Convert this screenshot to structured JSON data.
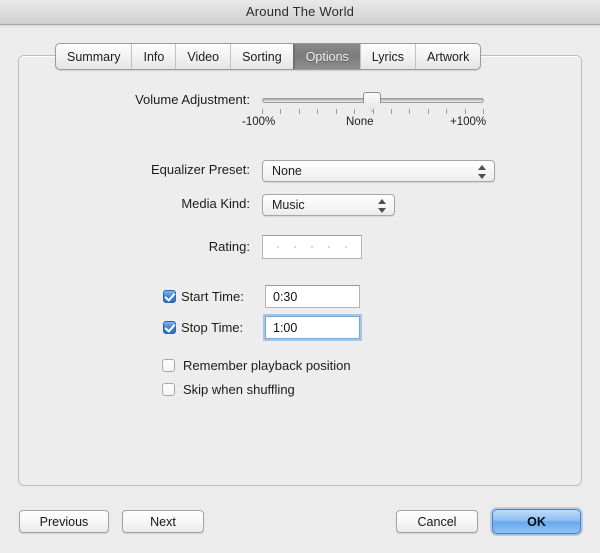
{
  "window": {
    "title": "Around The World"
  },
  "tabs": [
    {
      "label": "Summary",
      "active": false
    },
    {
      "label": "Info",
      "active": false
    },
    {
      "label": "Video",
      "active": false
    },
    {
      "label": "Sorting",
      "active": false
    },
    {
      "label": "Options",
      "active": true
    },
    {
      "label": "Lyrics",
      "active": false
    },
    {
      "label": "Artwork",
      "active": false
    }
  ],
  "form": {
    "volume": {
      "label": "Volume Adjustment:",
      "min_label": "-100%",
      "mid_label": "None",
      "max_label": "+100%",
      "value": "None",
      "tick_count": 13
    },
    "equalizer": {
      "label": "Equalizer Preset:",
      "value": "None"
    },
    "media_kind": {
      "label": "Media Kind:",
      "value": "Music"
    },
    "rating": {
      "label": "Rating:",
      "stars": 0,
      "max_stars": 5
    },
    "start_time": {
      "label": "Start Time:",
      "checked": true,
      "value": "0:30"
    },
    "stop_time": {
      "label": "Stop Time:",
      "checked": true,
      "value": "1:00",
      "focused": true
    },
    "remember_playback": {
      "label": "Remember playback position",
      "checked": false
    },
    "skip_shuffling": {
      "label": "Skip when shuffling",
      "checked": false
    }
  },
  "buttons": {
    "previous": "Previous",
    "next": "Next",
    "cancel": "Cancel",
    "ok": "OK"
  },
  "colors": {
    "accent": "#3e86d8",
    "default_button": "#69a9ee",
    "active_tab": "#7b7b7b"
  }
}
